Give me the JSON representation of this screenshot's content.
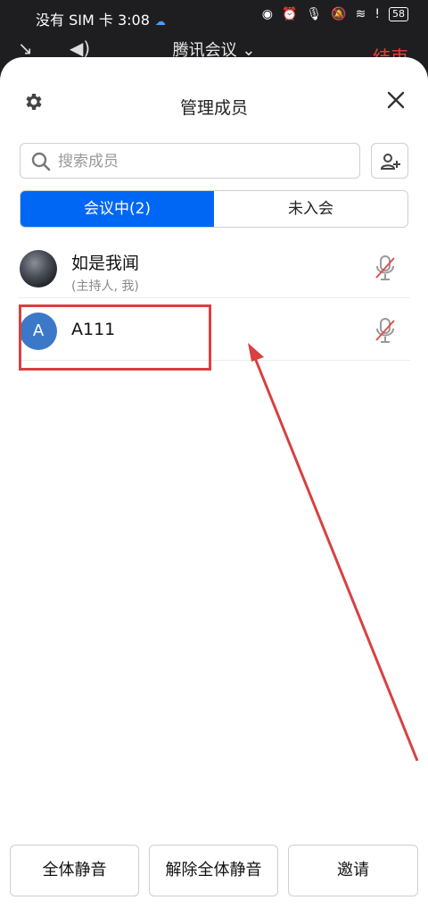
{
  "status_bar": {
    "carrier_time": "没有 SIM 卡 3:08",
    "battery": "58"
  },
  "top_bar": {
    "title": "腾讯会议",
    "end_label": "结束"
  },
  "sheet": {
    "title": "管理成员",
    "search": {
      "placeholder": "搜索成员",
      "value": ""
    },
    "tabs": [
      {
        "label": "会议中(2)",
        "active": true
      },
      {
        "label": "未入会",
        "active": false
      }
    ],
    "members": [
      {
        "name": "如是我闻",
        "role": "(主持人, 我)",
        "avatar": "photo",
        "muted": true
      },
      {
        "name": "A111",
        "role": "",
        "avatar_letter": "A",
        "muted": true
      }
    ],
    "buttons": {
      "mute_all": "全体静音",
      "unmute_all": "解除全体静音",
      "invite": "邀请"
    }
  },
  "colors": {
    "accent": "#0067f5",
    "annotation": "#d94040",
    "avatar_letter_bg": "#3c78c8",
    "end_red": "#f03a3a"
  }
}
